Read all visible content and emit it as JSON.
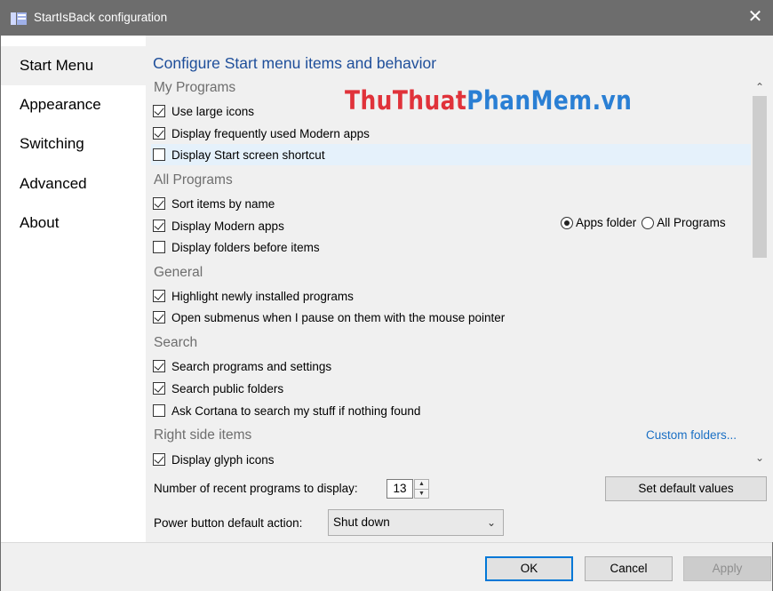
{
  "window": {
    "title": "StartIsBack configuration",
    "close_glyph": "✕"
  },
  "sidebar": {
    "items": [
      {
        "label": "Start Menu",
        "active": true
      },
      {
        "label": "Appearance"
      },
      {
        "label": "Switching"
      },
      {
        "label": "Advanced"
      },
      {
        "label": "About"
      }
    ]
  },
  "main": {
    "heading": "Configure Start menu items and behavior",
    "groups": {
      "my_programs": {
        "title": "My Programs",
        "items": [
          {
            "label": "Use large icons",
            "checked": true
          },
          {
            "label": "Display frequently used Modern apps",
            "checked": true
          },
          {
            "label": "Display Start screen shortcut",
            "checked": false
          }
        ]
      },
      "all_programs": {
        "title": "All Programs",
        "items": [
          {
            "label": "Sort items by name",
            "checked": true
          },
          {
            "label": "Display Modern apps",
            "checked": true
          },
          {
            "label": "Display folders before items",
            "checked": false
          }
        ],
        "radio": [
          {
            "label": "Apps folder",
            "selected": true
          },
          {
            "label": "All Programs",
            "selected": false
          }
        ]
      },
      "general": {
        "title": "General",
        "items": [
          {
            "label": "Highlight newly installed programs",
            "checked": true
          },
          {
            "label": "Open submenus when I pause on them with the mouse pointer",
            "checked": true
          }
        ]
      },
      "search": {
        "title": "Search",
        "items": [
          {
            "label": "Search programs and settings",
            "checked": true
          },
          {
            "label": "Search public folders",
            "checked": true
          },
          {
            "label": "Ask Cortana to search my stuff if nothing found",
            "checked": false
          }
        ]
      },
      "right_side": {
        "title": "Right side items",
        "link": "Custom folders...",
        "items": [
          {
            "label": "Display glyph icons",
            "checked": true
          }
        ]
      }
    },
    "recent": {
      "label": "Number of recent programs to display:",
      "value": "13"
    },
    "set_default_label": "Set default values",
    "power": {
      "label": "Power button default action:",
      "value": "Shut down"
    }
  },
  "footer": {
    "ok": "OK",
    "cancel": "Cancel",
    "apply": "Apply"
  },
  "watermark": {
    "part1": "ThuThuat",
    "part2": "PhanMem.vn"
  },
  "colors": {
    "accent": "#1e4e9a",
    "link": "#1a6fc4",
    "focus": "#0078d7",
    "titlebar": "#6d6d6d"
  }
}
